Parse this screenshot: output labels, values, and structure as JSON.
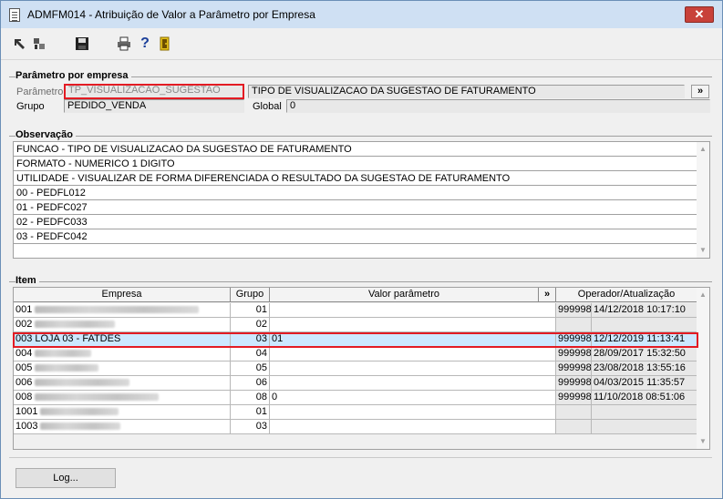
{
  "window": {
    "title": "ADMFM014 - Atribuição de Valor a Parâmetro por Empresa",
    "close": "✕"
  },
  "param_group": {
    "title": "Parâmetro por empresa",
    "param_label": "Parâmetro",
    "param_code": "TP_VISUALIZACAO_SUGESTAO",
    "param_desc": "TIPO DE VISUALIZACAO DA SUGESTAO DE FATURAMENTO",
    "more_button": "»",
    "group_label": "Grupo",
    "group_value": "PEDIDO_VENDA",
    "global_label": "Global",
    "global_value": "0"
  },
  "obs_group": {
    "title": "Observação",
    "lines": [
      "FUNCAO - TIPO DE VISUALIZACAO DA SUGESTAO DE FATURAMENTO",
      "FORMATO - NUMERICO 1 DIGITO",
      "UTILIDADE - VISUALIZAR DE FORMA DIFERENCIADA O RESULTADO DA SUGESTAO DE FATURAMENTO",
      "00 - PEDFL012",
      "01 - PEDFC027",
      "02 - PEDFC033",
      "03 - PEDFC042"
    ]
  },
  "item_group": {
    "title": "Item",
    "headers": {
      "empresa": "Empresa",
      "grupo": "Grupo",
      "valor": "Valor parâmetro",
      "more": "»",
      "operador": "Operador/Atualização"
    },
    "rows": [
      {
        "code": "001",
        "empresa": "",
        "grupo": "01",
        "valor": "",
        "operador": "999998",
        "atualizacao": "14/12/2018 10:17:10"
      },
      {
        "code": "002",
        "empresa": "",
        "grupo": "02",
        "valor": "",
        "operador": "",
        "atualizacao": ""
      },
      {
        "code": "003",
        "empresa": "LOJA 03 - FATDES",
        "grupo": "03",
        "valor": "01",
        "operador": "999998",
        "atualizacao": "12/12/2019 11:13:41"
      },
      {
        "code": "004",
        "empresa": "",
        "grupo": "04",
        "valor": "",
        "operador": "999998",
        "atualizacao": "28/09/2017 15:32:50"
      },
      {
        "code": "005",
        "empresa": "",
        "grupo": "05",
        "valor": "",
        "operador": "999998",
        "atualizacao": "23/08/2018 13:55:16"
      },
      {
        "code": "006",
        "empresa": "",
        "grupo": "06",
        "valor": "",
        "operador": "999998",
        "atualizacao": "04/03/2015 11:35:57"
      },
      {
        "code": "008",
        "empresa": "",
        "grupo": "08",
        "valor": "0",
        "operador": "999998",
        "atualizacao": "11/10/2018 08:51:06"
      },
      {
        "code": "1001",
        "empresa": "",
        "grupo": "01",
        "valor": "",
        "operador": "",
        "atualizacao": ""
      },
      {
        "code": "1003",
        "empresa": "",
        "grupo": "03",
        "valor": "",
        "operador": "",
        "atualizacao": ""
      }
    ],
    "selected_row": "003"
  },
  "footer": {
    "log_button": "Log..."
  },
  "toolbar": {
    "icons": [
      "first-icon",
      "last-icon",
      "save-icon",
      "print-icon",
      "help-icon",
      "exit-icon"
    ],
    "help_glyph": "?"
  }
}
